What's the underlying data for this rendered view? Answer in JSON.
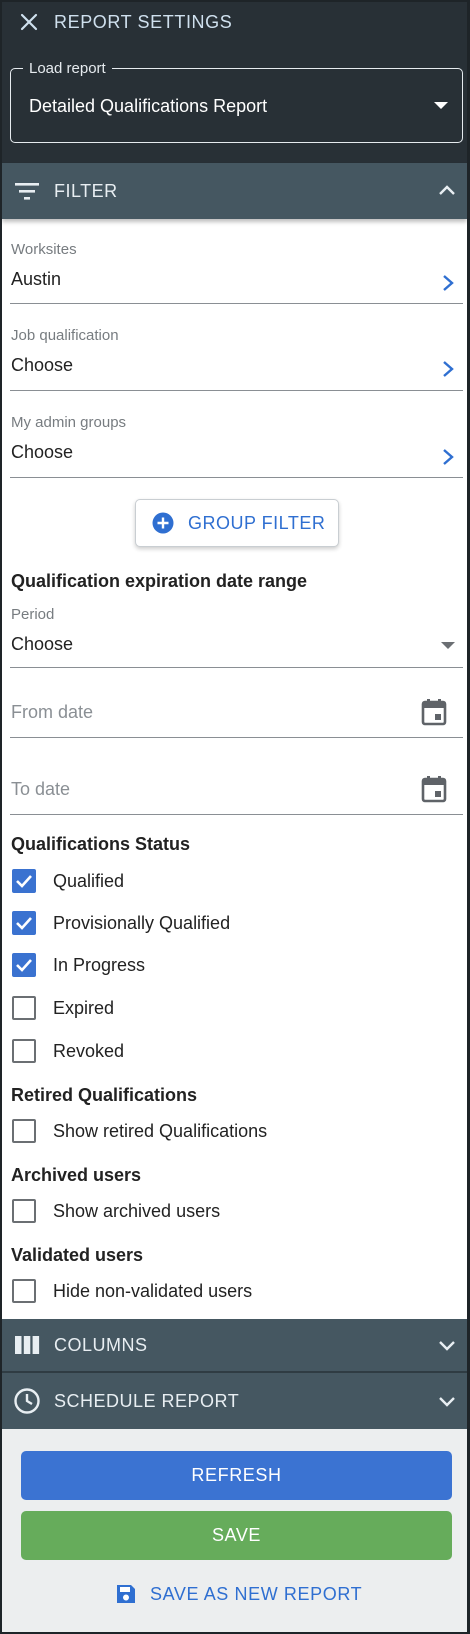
{
  "header": {
    "title": "REPORT SETTINGS",
    "load_report_label": "Load report",
    "load_report_value": "Detailed Qualifications Report"
  },
  "filter": {
    "title": "FILTER",
    "worksites": {
      "label": "Worksites",
      "value": "Austin"
    },
    "job_qualification": {
      "label": "Job qualification",
      "value": "Choose"
    },
    "admin_groups": {
      "label": "My admin groups",
      "value": "Choose"
    },
    "group_filter_label": "GROUP FILTER",
    "date_range": {
      "heading": "Qualification expiration date range",
      "period_label": "Period",
      "period_value": "Choose",
      "from_placeholder": "From date",
      "to_placeholder": "To date"
    },
    "status": {
      "heading": "Qualifications Status",
      "items": [
        {
          "label": "Qualified",
          "checked": true
        },
        {
          "label": "Provisionally Qualified",
          "checked": true
        },
        {
          "label": "In Progress",
          "checked": true
        },
        {
          "label": "Expired",
          "checked": false
        },
        {
          "label": "Revoked",
          "checked": false
        }
      ]
    },
    "retired": {
      "heading": "Retired Qualifications",
      "label": "Show retired Qualifications",
      "checked": false
    },
    "archived": {
      "heading": "Archived users",
      "label": "Show archived users",
      "checked": false
    },
    "validated": {
      "heading": "Validated users",
      "label": "Hide non-validated users",
      "checked": false
    }
  },
  "columns": {
    "title": "COLUMNS"
  },
  "schedule": {
    "title": "SCHEDULE REPORT"
  },
  "actions": {
    "refresh": "REFRESH",
    "save": "SAVE",
    "save_as_new": "SAVE AS NEW REPORT"
  },
  "colors": {
    "header_bg": "#283036",
    "section_bar": "#455761",
    "accent_blue": "#3b73d2",
    "save_green": "#66ac5b"
  }
}
